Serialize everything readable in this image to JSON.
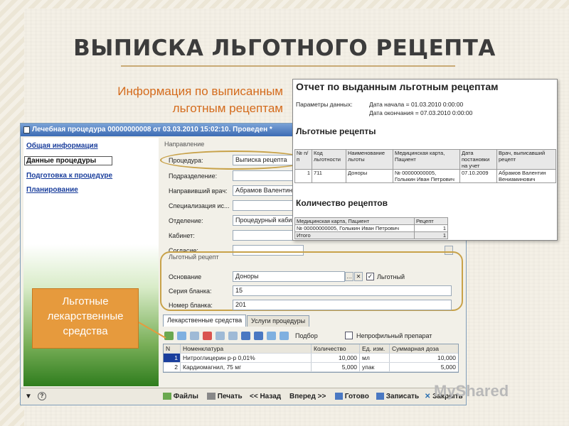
{
  "slide": {
    "title": "ВЫПИСКА ЛЬГОТНОГО РЕЦЕПТА",
    "subtitle_line1": "Информация по выписанным",
    "subtitle_line2": "льготным рецептам",
    "callout_line1": "Льготные",
    "callout_line2": "лекарственные",
    "callout_line3": "средства",
    "watermark": "MyShared",
    "accent_color": "#d46b1c",
    "callout_color": "#e69a3d"
  },
  "window": {
    "title": "Лечебная процедура 00000000008 от 03.03.2010 15:02:10. Проведен *",
    "nav": [
      {
        "label": "Общая информация"
      },
      {
        "label": "Данные процедуры"
      },
      {
        "label": "Подготовка к процедуре"
      },
      {
        "label": "Планирование"
      }
    ],
    "direction_group": "Направление",
    "fields": {
      "procedure_label": "Процедура:",
      "procedure_value": "Выписка рецепта",
      "department_label": "Подразделение:",
      "doctor_label": "Направивший врач:",
      "doctor_value": "Абрамов Валентин",
      "spec_label": "Специализация ис...",
      "dept_label": "Отделение:",
      "dept_value": "Процедурный кабинет",
      "cabinet_label": "Кабинет:",
      "consent_label": "Согласие:"
    },
    "recipe_group": "Льготный рецепт",
    "recipe": {
      "basis_label": "Основание",
      "basis_value": "Доноры",
      "privileged_label": "Льготный",
      "series_label": "Серия бланка:",
      "series_value": "15",
      "number_label": "Номер бланка:",
      "number_value": "201"
    },
    "tabs": [
      {
        "label": "Лекарственные средства"
      },
      {
        "label": "Услуги процедуры"
      }
    ],
    "toolbar": {
      "selection_label": "Подбор",
      "nonprofile_label": "Непрофильный препарат"
    },
    "grid": {
      "headers": [
        "N",
        "Номенклатура",
        "Количество",
        "Ед. изм.",
        "Суммарная доза"
      ],
      "rows": [
        [
          "1",
          "Нитроглицерин р-р 0,01%",
          "10,000",
          "мл",
          "10,000"
        ],
        [
          "2",
          "Кардиомагнил, 75 мг",
          "5,000",
          "упак",
          "5,000"
        ]
      ]
    },
    "statusbar": {
      "files": "Файлы",
      "print": "Печать",
      "back": "<< Назад",
      "forward": "Вперед >>",
      "done": "Готово",
      "save": "Записать",
      "close": "Закрыть"
    }
  },
  "report": {
    "title": "Отчет по выданным льготным рецептам",
    "params_label": "Параметры данных:",
    "date_start": "Дата начала = 01.03.2010 0:00:00",
    "date_end": "Дата окончания = 07.03.2010 0:00:00",
    "section1": "Льготные рецепты",
    "table1_headers": [
      "№ п/п",
      "Код льготности",
      "Наименование льготы",
      "Медицинская карта, Пациент",
      "Дата постановки на учет",
      "Врач, выписавший рецепт"
    ],
    "table1_row": [
      "1",
      "711",
      "Доноры",
      "№ 00000000005, Голыкин Иван Петрович",
      "07.10.2009",
      "Абрамов Валентин Вениаминович"
    ],
    "section2": "Количество рецептов",
    "table2_headers": [
      "Медицинская карта, Пациент",
      "Рецепт"
    ],
    "table2_row": [
      "№ 00000000005, Голыкин Иван Петрович",
      "1"
    ],
    "table2_total": [
      "Итого",
      "1"
    ]
  }
}
